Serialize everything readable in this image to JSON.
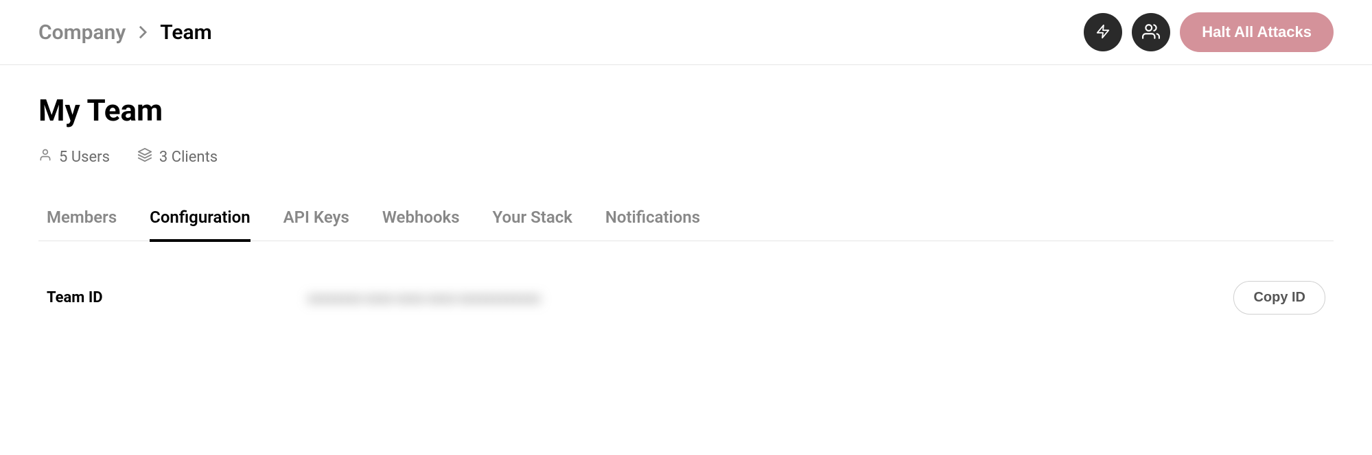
{
  "breadcrumb": {
    "parent": "Company",
    "current": "Team"
  },
  "header": {
    "halt_label": "Halt All Attacks"
  },
  "page": {
    "title": "My Team"
  },
  "stats": {
    "users": "5 Users",
    "clients": "3 Clients"
  },
  "tabs": [
    {
      "label": "Members",
      "active": false
    },
    {
      "label": "Configuration",
      "active": true
    },
    {
      "label": "API Keys",
      "active": false
    },
    {
      "label": "Webhooks",
      "active": false
    },
    {
      "label": "Your Stack",
      "active": false
    },
    {
      "label": "Notifications",
      "active": false
    }
  ],
  "config": {
    "team_id_label": "Team ID",
    "team_id_value": "xxxxxxxx-xxxx-xxxx-xxxx-xxxxxxxxxxxx",
    "copy_label": "Copy ID"
  }
}
